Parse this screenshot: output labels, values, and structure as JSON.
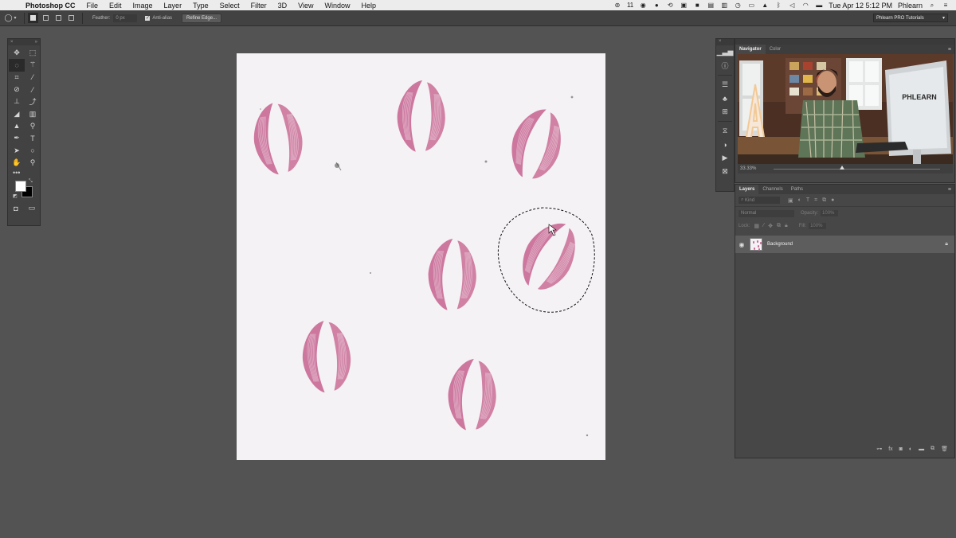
{
  "menubar": {
    "apple": "",
    "app": "Photoshop CC",
    "items": [
      "File",
      "Edit",
      "Image",
      "Layer",
      "Type",
      "Select",
      "Filter",
      "3D",
      "View",
      "Window",
      "Help"
    ],
    "status_badge": "11",
    "clock": "Tue Apr 12  5:12 PM",
    "user": "Phlearn"
  },
  "options": {
    "feather_label": "Feather:",
    "feather_value": "0 px",
    "antialias_label": "Anti-alias",
    "refine_edge_label": "Refine Edge...",
    "workspace": "Phlearn PRO Tutorials"
  },
  "canvas": {
    "background": "#f4f2f4",
    "lipstick_color": "#c25585"
  },
  "navigator_panel": {
    "tabs": [
      "Navigator",
      "Color"
    ],
    "zoom": "33.33%",
    "preview_sign_text": "PHLEARN"
  },
  "layers_panel": {
    "tabs": [
      "Layers",
      "Channels",
      "Paths"
    ],
    "filter_kind": "Kind",
    "blend_mode": "Normal",
    "opacity_label": "Opacity:",
    "opacity_value": "100%",
    "lock_label": "Lock:",
    "fill_label": "Fill:",
    "fill_value": "100%",
    "layer_name": "Background"
  }
}
